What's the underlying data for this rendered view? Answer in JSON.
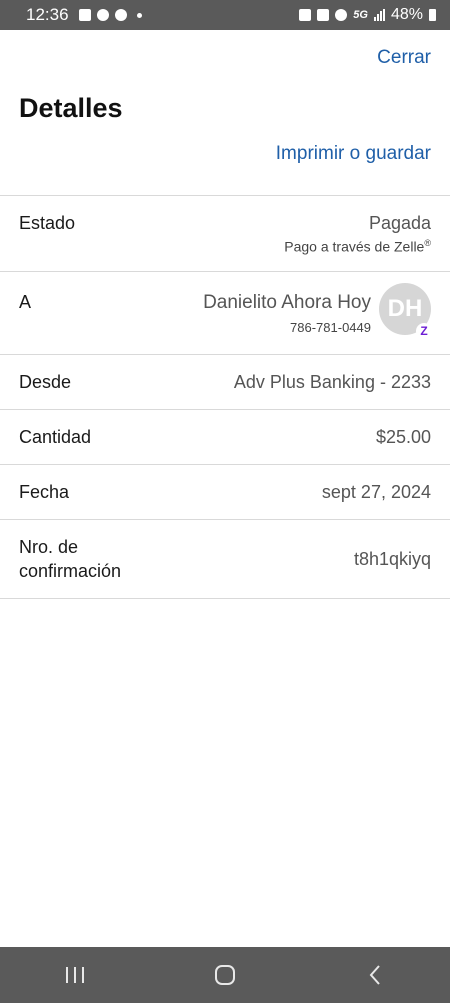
{
  "status_bar": {
    "time": "12:36",
    "network": "5G",
    "battery": "48%"
  },
  "header": {
    "close_label": "Cerrar",
    "title": "Detalles",
    "print_label": "Imprimir o guardar"
  },
  "details": {
    "estado": {
      "label": "Estado",
      "value": "Pagada",
      "sub": "Pago a través de Zelle",
      "sub_mark": "®"
    },
    "a": {
      "label": "A",
      "name": "Danielito Ahora Hoy",
      "phone": "786-781-0449",
      "initials": "DH",
      "badge": "Z"
    },
    "desde": {
      "label": "Desde",
      "value": "Adv Plus Banking - 2233"
    },
    "cantidad": {
      "label": "Cantidad",
      "value": "$25.00"
    },
    "fecha": {
      "label": "Fecha",
      "value": "sept 27, 2024"
    },
    "confirmacion": {
      "label_line1": "Nro. de",
      "label_line2": "confirmación",
      "value": "t8h1qkiyq"
    }
  },
  "colors": {
    "link": "#1f5fa8",
    "zelle": "#6d1ed4",
    "system_bar": "#5a5a5a"
  },
  "icons": {
    "nav_recents": "recents-icon",
    "nav_home": "home-icon",
    "nav_back": "back-icon"
  }
}
